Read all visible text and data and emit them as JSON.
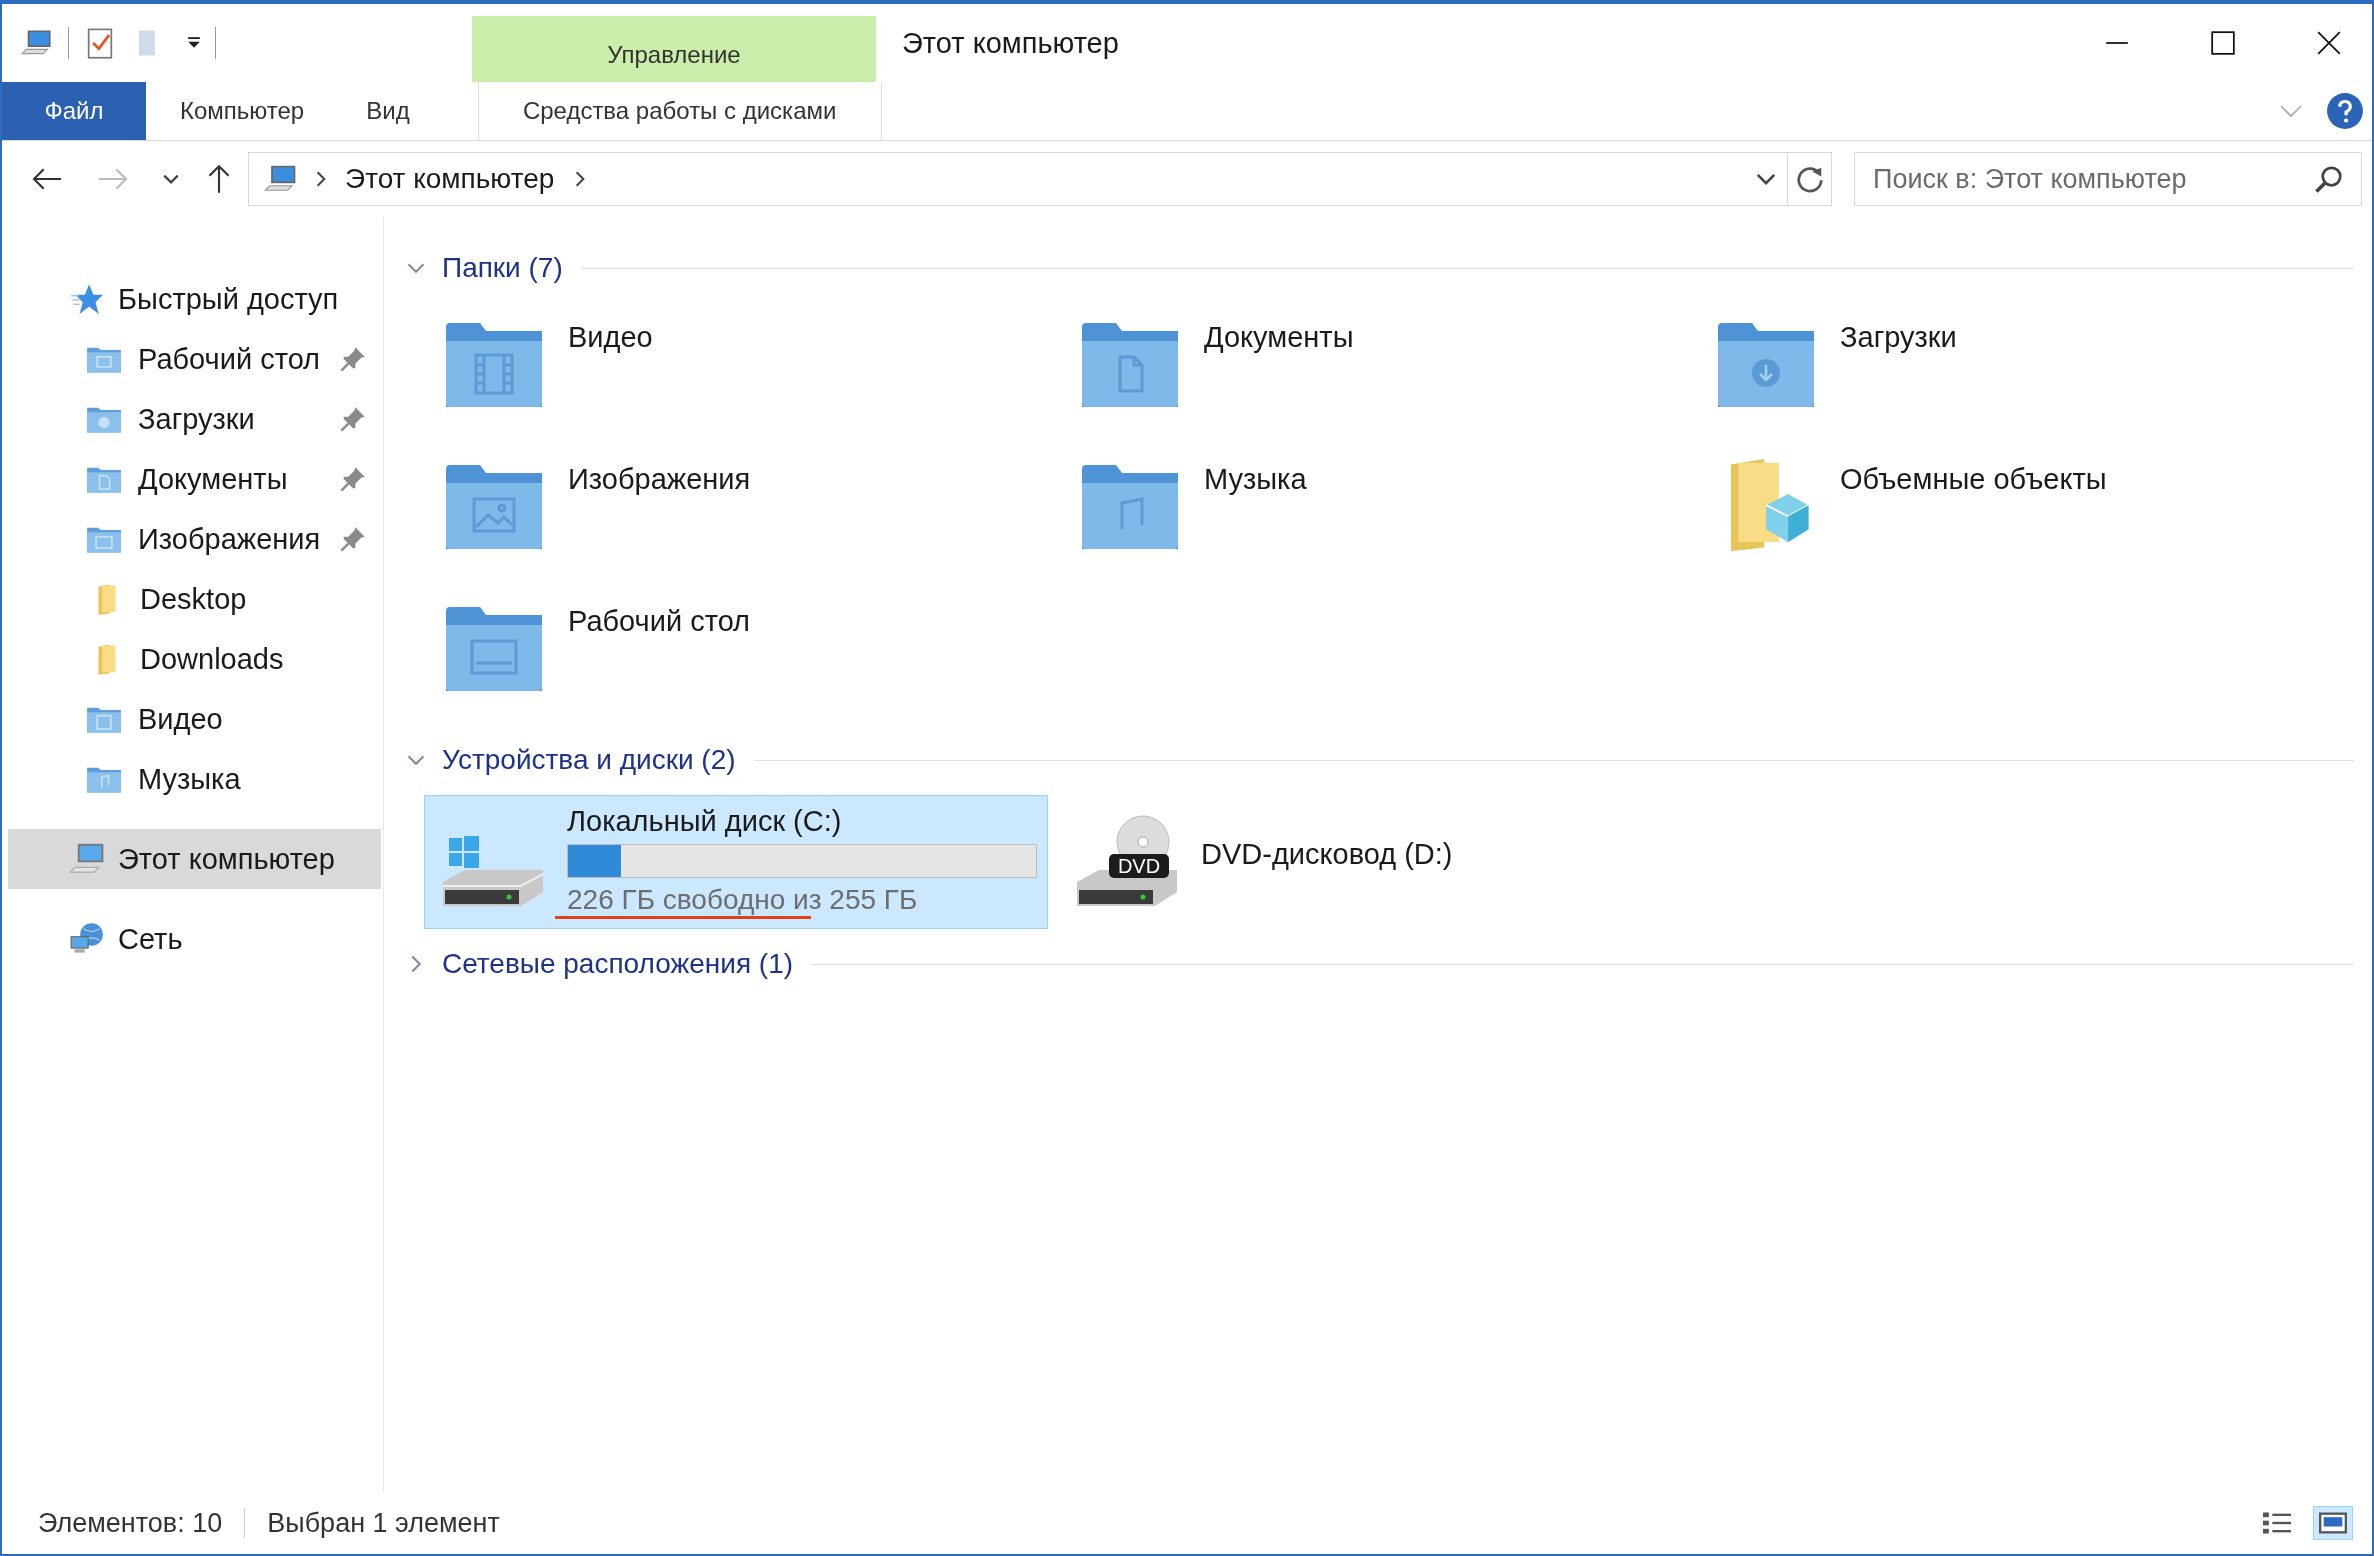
{
  "window": {
    "title": "Этот компьютер"
  },
  "context_tab": {
    "label": "Управление"
  },
  "ribbon_tabs": [
    {
      "label": "Файл",
      "kind": "file",
      "selected": false
    },
    {
      "label": "Компьютер",
      "kind": "tab",
      "selected": false
    },
    {
      "label": "Вид",
      "kind": "tab",
      "selected": false
    },
    {
      "label": "Средства работы с дисками",
      "kind": "context",
      "selected": false
    }
  ],
  "address": {
    "path": [
      "Этот компьютер"
    ]
  },
  "search": {
    "placeholder": "Поиск в: Этот компьютер"
  },
  "sidebar": {
    "items": [
      {
        "label": "Быстрый доступ",
        "kind": "star",
        "selected": false,
        "children": [
          {
            "label": "Рабочий стол",
            "kind": "desktop",
            "pinned": true,
            "selected": false
          },
          {
            "label": "Загрузки",
            "kind": "downloads",
            "pinned": true,
            "selected": false
          },
          {
            "label": "Документы",
            "kind": "documents",
            "pinned": true,
            "selected": false
          },
          {
            "label": "Изображения",
            "kind": "images",
            "pinned": true,
            "selected": false
          },
          {
            "label": "Desktop",
            "kind": "yellow",
            "pinned": false,
            "selected": false
          },
          {
            "label": "Downloads",
            "kind": "yellow",
            "pinned": false,
            "selected": false
          },
          {
            "label": "Видео",
            "kind": "video",
            "pinned": false,
            "selected": false
          },
          {
            "label": "Музыка",
            "kind": "music",
            "pinned": false,
            "selected": false
          }
        ]
      },
      {
        "label": "Этот компьютер",
        "kind": "pc",
        "selected": true
      },
      {
        "label": "Сеть",
        "kind": "network",
        "selected": false
      }
    ]
  },
  "groups": [
    {
      "title": "Папки (7)",
      "expanded": true,
      "items": [
        {
          "label": "Видео",
          "kind": "video"
        },
        {
          "label": "Документы",
          "kind": "documents"
        },
        {
          "label": "Загрузки",
          "kind": "downloads"
        },
        {
          "label": "Изображения",
          "kind": "images"
        },
        {
          "label": "Музыка",
          "kind": "music"
        },
        {
          "label": "Объемные объекты",
          "kind": "objects"
        },
        {
          "label": "Рабочий стол",
          "kind": "desktop"
        }
      ]
    },
    {
      "title": "Устройства и диски (2)",
      "expanded": true,
      "items": [
        {
          "label": "Локальный диск (C:)",
          "kind": "hdd",
          "selected": true,
          "level": 0.114,
          "capacity": "226 ГБ свободно из 255 ГБ",
          "underlined": true
        },
        {
          "label": "DVD-дисковод (D:)",
          "kind": "dvd",
          "icon_text": "DVD",
          "selected": false,
          "underlined": false
        }
      ]
    },
    {
      "title": "Сетевые расположения (1)",
      "expanded": false
    }
  ],
  "status_bar": {
    "items": [
      "Элементов: 10",
      "Выбран 1 элемент"
    ],
    "views": [
      {
        "kind": "details",
        "selected": false
      },
      {
        "kind": "large",
        "selected": true
      }
    ]
  }
}
